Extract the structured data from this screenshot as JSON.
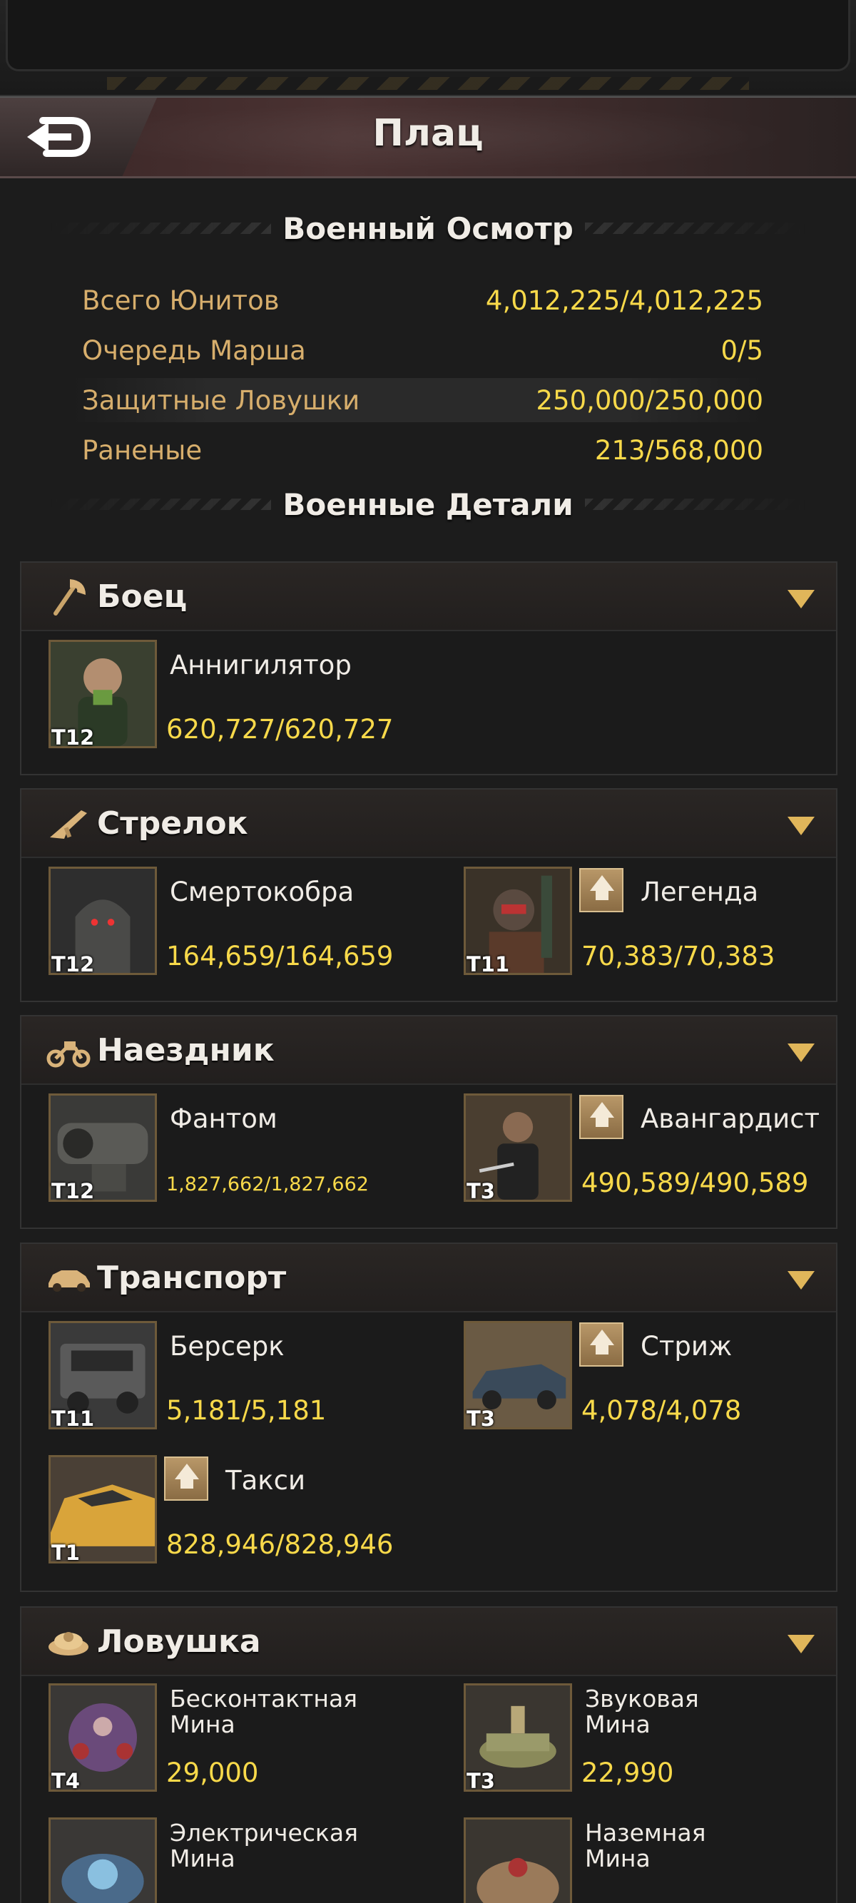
{
  "header": {
    "title": "Плац",
    "back_icon": "back-arrow-icon"
  },
  "review": {
    "heading": "Военный Осмотр",
    "stats": [
      {
        "label": "Всего Юнитов",
        "value": "4,012,225/4,012,225"
      },
      {
        "label": "Очередь Марша",
        "value": "0/5"
      },
      {
        "label": "Защитные Ловушки",
        "value": "250,000/250,000"
      },
      {
        "label": "Раненые",
        "value": "213/568,000"
      }
    ]
  },
  "details": {
    "heading": "Военные Детали",
    "categories": [
      {
        "name": "Боец",
        "icon": "axe-icon",
        "units": [
          {
            "name": "Аннигилятор",
            "tier": "T12",
            "count": "620,727/620,727",
            "upgrade": false
          }
        ]
      },
      {
        "name": "Стрелок",
        "icon": "rifle-icon",
        "units": [
          {
            "name": "Смертокобра",
            "tier": "T12",
            "count": "164,659/164,659",
            "upgrade": false
          },
          {
            "name": "Легенда",
            "tier": "T11",
            "count": "70,383/70,383",
            "upgrade": true
          }
        ]
      },
      {
        "name": "Наездник",
        "icon": "motorcycle-icon",
        "units": [
          {
            "name": "Фантом",
            "tier": "T12",
            "count": "1,827,662/1,827,662",
            "upgrade": false
          },
          {
            "name": "Авангардист",
            "tier": "T3",
            "count": "490,589/490,589",
            "upgrade": true
          }
        ]
      },
      {
        "name": "Транспорт",
        "icon": "car-icon",
        "units": [
          {
            "name": "Берсерк",
            "tier": "T11",
            "count": "5,181/5,181",
            "upgrade": false
          },
          {
            "name": "Стриж",
            "tier": "T3",
            "count": "4,078/4,078",
            "upgrade": true
          },
          {
            "name": "Такси",
            "tier": "T1",
            "count": "828,946/828,946",
            "upgrade": true
          }
        ]
      },
      {
        "name": "Ловушка",
        "icon": "landmine-icon",
        "units": [
          {
            "name": "Бесконтактная Мина",
            "tier": "T4",
            "count": "29,000",
            "upgrade": false
          },
          {
            "name": "Звуковая Мина",
            "tier": "T3",
            "count": "22,990",
            "upgrade": false
          },
          {
            "name": "Электрическая Мина",
            "tier": "",
            "count": "",
            "upgrade": false
          },
          {
            "name": "Наземная Мина",
            "tier": "",
            "count": "",
            "upgrade": false
          }
        ]
      }
    ]
  },
  "colors": {
    "label_gold": "#d7ae6c",
    "value_yellow": "#f8d94a",
    "chevron": "#e0b65a"
  }
}
